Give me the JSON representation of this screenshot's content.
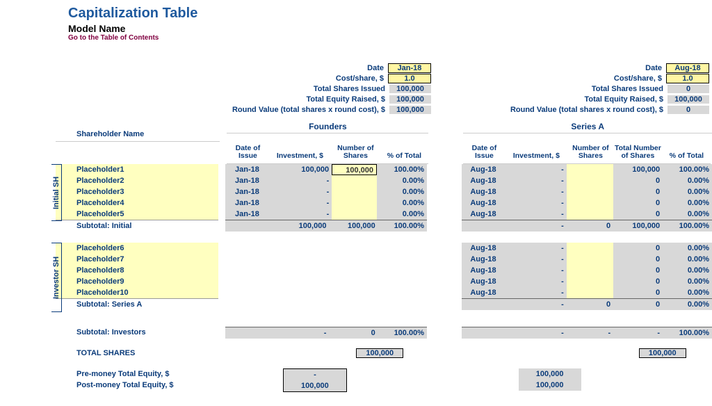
{
  "header": {
    "title": "Capitalization Table",
    "model_name": "Model Name",
    "toc_link": "Go to the Table of Contents"
  },
  "metrics_labels": {
    "date": "Date",
    "cost_share": "Cost/share, $",
    "total_shares": "Total Shares Issued",
    "total_equity": "Total Equity Raised, $",
    "round_value": "Round Value (total shares x round cost), $"
  },
  "founders_metrics": {
    "date": "Jan-18",
    "cost_share": "1.0",
    "total_shares": "100,000",
    "total_equity": "100,000",
    "round_value": "100,000"
  },
  "seriesA_metrics": {
    "date": "Aug-18",
    "cost_share": "1.0",
    "total_shares": "0",
    "total_equity": "100,000",
    "round_value": "0"
  },
  "section_labels": {
    "founders": "Founders",
    "seriesA": "Series A",
    "shareholder_name": "Shareholder Name",
    "initial_sh": "Initial SH",
    "investor_sh": "Investor SH"
  },
  "col_headers": {
    "date_issue": "Date of Issue",
    "investment": "Investment, $",
    "num_shares": "Number of Shares",
    "total_num_shares": "Total Number of Shares",
    "pct_total": "% of Total"
  },
  "initial_rows": [
    {
      "name": "Placeholder1",
      "f_date": "Jan-18",
      "f_inv": "100,000",
      "f_sh": "100,000",
      "f_pct": "100.00%",
      "s_date": "Aug-18",
      "s_inv": "-",
      "s_sh": "",
      "s_tot": "100,000",
      "s_pct": "100.00%"
    },
    {
      "name": "Placeholder2",
      "f_date": "Jan-18",
      "f_inv": "-",
      "f_sh": "",
      "f_pct": "0.00%",
      "s_date": "Aug-18",
      "s_inv": "-",
      "s_sh": "",
      "s_tot": "0",
      "s_pct": "0.00%"
    },
    {
      "name": "Placeholder3",
      "f_date": "Jan-18",
      "f_inv": "-",
      "f_sh": "",
      "f_pct": "0.00%",
      "s_date": "Aug-18",
      "s_inv": "-",
      "s_sh": "",
      "s_tot": "0",
      "s_pct": "0.00%"
    },
    {
      "name": "Placeholder4",
      "f_date": "Jan-18",
      "f_inv": "-",
      "f_sh": "",
      "f_pct": "0.00%",
      "s_date": "Aug-18",
      "s_inv": "-",
      "s_sh": "",
      "s_tot": "0",
      "s_pct": "0.00%"
    },
    {
      "name": "Placeholder5",
      "f_date": "Jan-18",
      "f_inv": "-",
      "f_sh": "",
      "f_pct": "0.00%",
      "s_date": "Aug-18",
      "s_inv": "-",
      "s_sh": "",
      "s_tot": "0",
      "s_pct": "0.00%"
    }
  ],
  "subtotal_initial": {
    "label": "Subtotal: Initial",
    "f_inv": "100,000",
    "f_sh": "100,000",
    "f_pct": "100.00%",
    "s_inv": "-",
    "s_sh": "0",
    "s_tot": "100,000",
    "s_pct": "100.00%"
  },
  "investor_rows": [
    {
      "name": "Placeholder6",
      "s_date": "Aug-18",
      "s_inv": "-",
      "s_sh": "",
      "s_tot": "0",
      "s_pct": "0.00%"
    },
    {
      "name": "Placeholder7",
      "s_date": "Aug-18",
      "s_inv": "-",
      "s_sh": "",
      "s_tot": "0",
      "s_pct": "0.00%"
    },
    {
      "name": "Placeholder8",
      "s_date": "Aug-18",
      "s_inv": "-",
      "s_sh": "",
      "s_tot": "0",
      "s_pct": "0.00%"
    },
    {
      "name": "Placeholder9",
      "s_date": "Aug-18",
      "s_inv": "-",
      "s_sh": "",
      "s_tot": "0",
      "s_pct": "0.00%"
    },
    {
      "name": "Placeholder10",
      "s_date": "Aug-18",
      "s_inv": "-",
      "s_sh": "",
      "s_tot": "0",
      "s_pct": "0.00%"
    }
  ],
  "subtotal_seriesA": {
    "label": "Subtotal: Series A",
    "s_inv": "-",
    "s_sh": "0",
    "s_tot": "0",
    "s_pct": "0.00%"
  },
  "subtotal_investors": {
    "label": "Subtotal: Investors",
    "f_inv": "-",
    "f_sh": "0",
    "f_pct": "100.00%",
    "s_inv": "-",
    "s_sh": "-",
    "s_tot": "-",
    "s_pct": "100.00%"
  },
  "bottom": {
    "total_shares_label": "TOTAL SHARES",
    "total_shares_f": "100,000",
    "total_shares_s": "100,000",
    "pre_money_label": "Pre-money Total Equity, $",
    "post_money_label": "Post-money Total Equity, $",
    "pre_f": "-",
    "post_f": "100,000",
    "pre_s": "100,000",
    "post_s": "100,000"
  }
}
